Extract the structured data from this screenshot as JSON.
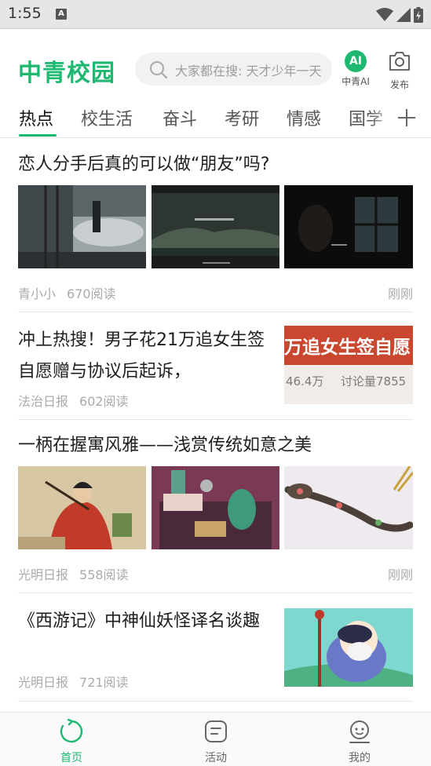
{
  "status_bar": {
    "time": "1:55",
    "notification_letter": "A"
  },
  "header": {
    "logo": "中青校园",
    "search_placeholder": "大家都在搜: 天才少年一天",
    "ai_label": "中青AI",
    "ai_badge": "AI",
    "publish_label": "发布"
  },
  "tabs": [
    "热点",
    "校生活",
    "奋斗",
    "考研",
    "情感",
    "国学"
  ],
  "articles": [
    {
      "title": "恋人分手后真的可以做“朋友”吗?",
      "source": "青小小",
      "views": "670阅读",
      "time": "刚刚"
    },
    {
      "title": "冲上热搜！男子花21万追女生签自愿赠与协议后起诉，",
      "source": "法治日报",
      "views": "602阅读",
      "thumb_text": "万追女生签自愿",
      "thumb_subtext_left": "46.4万",
      "thumb_subtext_right": "讨论量7855"
    },
    {
      "title": "一柄在握寓风雅——浅赏传统如意之美",
      "source": "光明日报",
      "views": "558阅读",
      "time": "刚刚"
    },
    {
      "title": "《西游记》中神仙妖怪译名谈趣",
      "source": "光明日报",
      "views": "721阅读"
    }
  ],
  "bottom_nav": [
    {
      "label": "首页",
      "icon": "home-refresh-icon",
      "active": true
    },
    {
      "label": "活动",
      "icon": "activity-icon",
      "active": false
    },
    {
      "label": "我的",
      "icon": "profile-icon",
      "active": false
    }
  ],
  "colors": {
    "accent": "#1fb871",
    "meta_text": "#aaaaaa",
    "divider": "#e6e6e6"
  }
}
